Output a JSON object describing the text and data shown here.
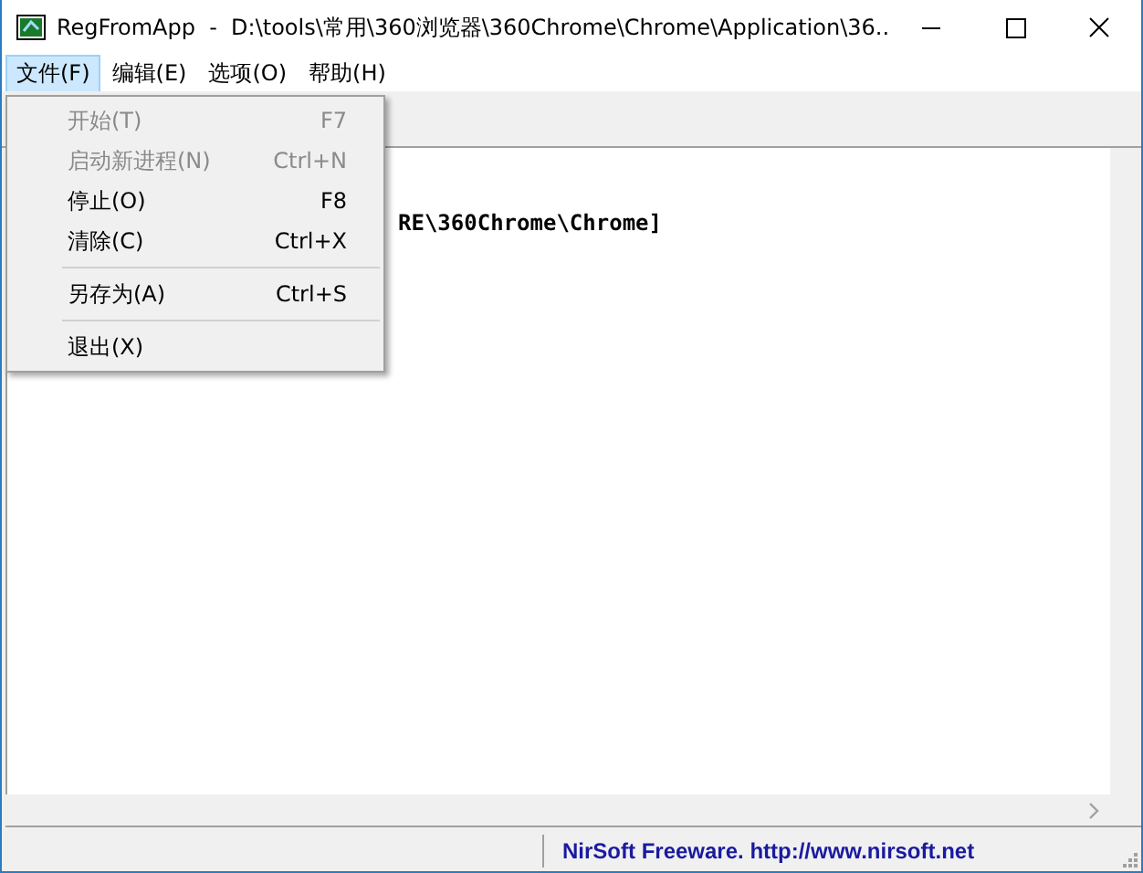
{
  "window": {
    "title": "RegFromApp  -  D:\\tools\\常用\\360浏览器\\360Chrome\\Chrome\\Application\\36..."
  },
  "menu_bar": [
    {
      "label": "文件(F)",
      "selected": true
    },
    {
      "label": "编辑(E)",
      "selected": false
    },
    {
      "label": "选项(O)",
      "selected": false
    },
    {
      "label": "帮助(H)",
      "selected": false
    }
  ],
  "file_menu": [
    {
      "kind": "item",
      "label": "开始(T)",
      "shortcut": "F7",
      "disabled": true
    },
    {
      "kind": "item",
      "label": "启动新进程(N)",
      "shortcut": "Ctrl+N",
      "disabled": true
    },
    {
      "kind": "item",
      "label": "停止(O)",
      "shortcut": "F8",
      "disabled": false
    },
    {
      "kind": "item",
      "label": "清除(C)",
      "shortcut": "Ctrl+X",
      "disabled": false
    },
    {
      "kind": "separator"
    },
    {
      "kind": "item",
      "label": "另存为(A)",
      "shortcut": "Ctrl+S",
      "disabled": false
    },
    {
      "kind": "separator"
    },
    {
      "kind": "item",
      "label": "退出(X)",
      "disabled": false
    }
  ],
  "content": {
    "lines": [
      "RE\\360Chrome\\Chrome]"
    ]
  },
  "status_bar": {
    "text": "NirSoft Freeware.  http://www.nirsoft.net"
  }
}
